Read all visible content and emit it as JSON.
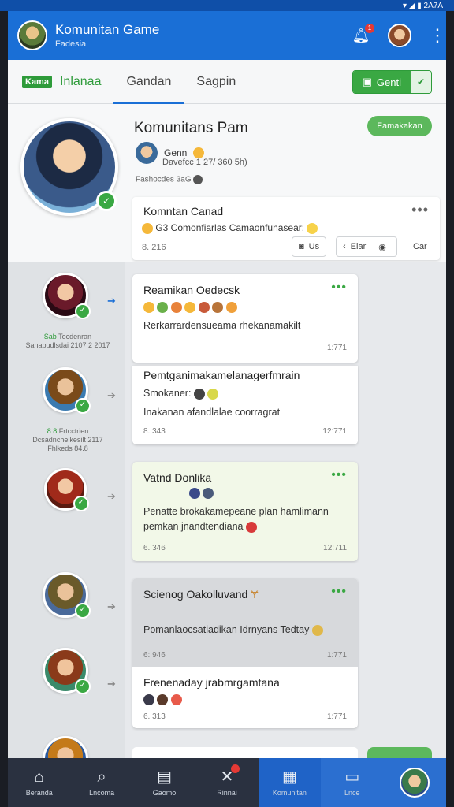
{
  "status": {
    "right": "▾ ◢ ▮ 2A7A"
  },
  "app": {
    "title": "Komunitan Game",
    "subtitle": "Fadesia",
    "notif_count": "1",
    "menu_icon": "kebab-icon"
  },
  "tabs": {
    "badge": "Kama",
    "items": [
      "Inlanaa",
      "Gandan",
      "Sagpin"
    ],
    "active_index": 1,
    "join_label": "Genti"
  },
  "profile": {
    "name": "Komunitans Pam",
    "follow_label": "Famakakan",
    "author": "Genn",
    "date": "Davefcc 1 27/ 360 5h)",
    "footer": "Fashocdes 3aG"
  },
  "intro_card": {
    "title": "Komntan Canad",
    "body": "G3 Comonfiarlas Camaonfunasear:",
    "foot": "8. 216",
    "ctrl_a": "Us",
    "ctrl_b": "Elar",
    "ctrl_c": "Car"
  },
  "rail": [
    {
      "label_green": "Sab",
      "label_rest": "Tocdenran",
      "label2": "Sanabudlsdai 2107 2 2017"
    },
    {
      "label_green": "8:8",
      "label_rest": "Frtcctrien",
      "label2": "Dcsadncheikesilt 2117",
      "label3": "Fhlkeds 84.8"
    }
  ],
  "cards": [
    {
      "title": "Reamikan Oedecsk",
      "line1": "Rerkarrardensueama rhekanamakilt",
      "foot_l": "",
      "foot_r": "1:771"
    },
    {
      "title": "Pemtganimakamelanagerfmrain",
      "line1": "Smokaner:",
      "line2": "Inakanan afandlalae coorragrat",
      "foot_l": "8. 343",
      "foot_r": "12:771"
    },
    {
      "title": "Vatnd Donlika",
      "line1": "Penatte brokakamepeane plan hamlimann",
      "line2": "pemkan jnandtendiana",
      "foot_l": "6. 346",
      "foot_r": "12:711"
    },
    {
      "title": "Scienog Oakolluvand",
      "line1": "Pomanlaocsatiadikan Idrnyans Tedtay",
      "foot_l": "6: 946",
      "foot_r": "1:771"
    },
    {
      "title": "Frenenaday jrabmrgamtana",
      "foot_l": "6. 313",
      "foot_r": "1:771"
    }
  ],
  "bottom_nav": [
    {
      "icon": "home-icon",
      "glyph": "⌂",
      "label": "Beranda"
    },
    {
      "icon": "search-icon",
      "glyph": "⌕",
      "label": "Lncoma"
    },
    {
      "icon": "calendar-icon",
      "glyph": "▤",
      "label": "Gaomo"
    },
    {
      "icon": "tools-icon",
      "glyph": "✕",
      "label": "Rinnai",
      "dot": true
    },
    {
      "icon": "grid-icon",
      "glyph": "▦",
      "label": "Komunitan",
      "active": true
    },
    {
      "icon": "briefcase-icon",
      "glyph": "▭",
      "label": "Lnce"
    }
  ],
  "colors": {
    "brand": "#1a6fd6",
    "accent": "#3aa843",
    "nav": "#2a3140"
  }
}
